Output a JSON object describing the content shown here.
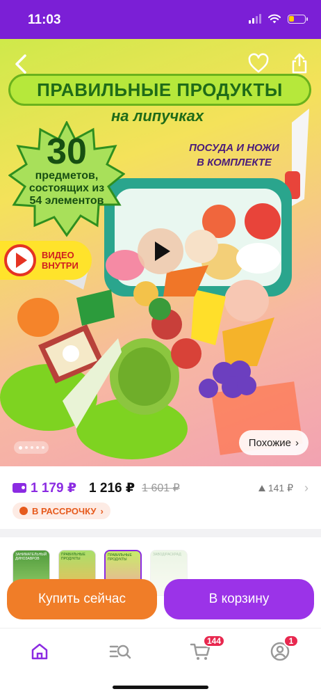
{
  "status_bar": {
    "time": "11:03",
    "battery_level": 0.35,
    "battery_color": "#ffcc00"
  },
  "hero": {
    "nav": {
      "back_icon": "chevron-left-icon",
      "favorite_icon": "heart-icon",
      "share_icon": "share-icon"
    },
    "banner_title": "ПРАВИЛЬНЫЕ ПРОДУКТЫ",
    "banner_subtitle": "на липучках",
    "badge_number": "30",
    "badge_line1": "предметов,",
    "badge_line2": "состоящих из",
    "badge_line3": "54 элементов",
    "kit_line1": "ПОСУДА И НОЖИ",
    "kit_line2": "В КОМПЛЕКТЕ",
    "video_line1": "ВИДЕО",
    "video_line2": "ВНУТРИ",
    "similar_label": "Похожие",
    "gallery_current": 1,
    "gallery_total": 5
  },
  "pricing": {
    "card_price": "1 179 ₽",
    "price": "1 216 ₽",
    "old_price": "1 601 ₽",
    "price_drop": "141 ₽",
    "installment_label": "В РАССРОЧКУ",
    "accent_color": "#8b2be2",
    "installment_color": "#e65a1c"
  },
  "variants": {
    "thumb1": "ЗАНИМАТЕЛЬНЫЙ ДИНОЗАВРОВ",
    "thumb2": "ПРАВИЛЬНЫЕ ПРОДУКТЫ",
    "thumb3": "ПРАВИЛЬНЫЕ ПРОДУКТЫ",
    "thumb4": "ЗАВОД/РАСКРАД"
  },
  "actions": {
    "buy_now": "Купить сейчас",
    "add_to_cart": "В корзину",
    "buy_color": "#f07d28",
    "cart_color": "#9b33e8"
  },
  "bottom_nav": {
    "cart_badge": "144",
    "profile_badge": "1",
    "items": [
      "home-icon",
      "catalog-search-icon",
      "cart-icon",
      "profile-icon"
    ]
  }
}
